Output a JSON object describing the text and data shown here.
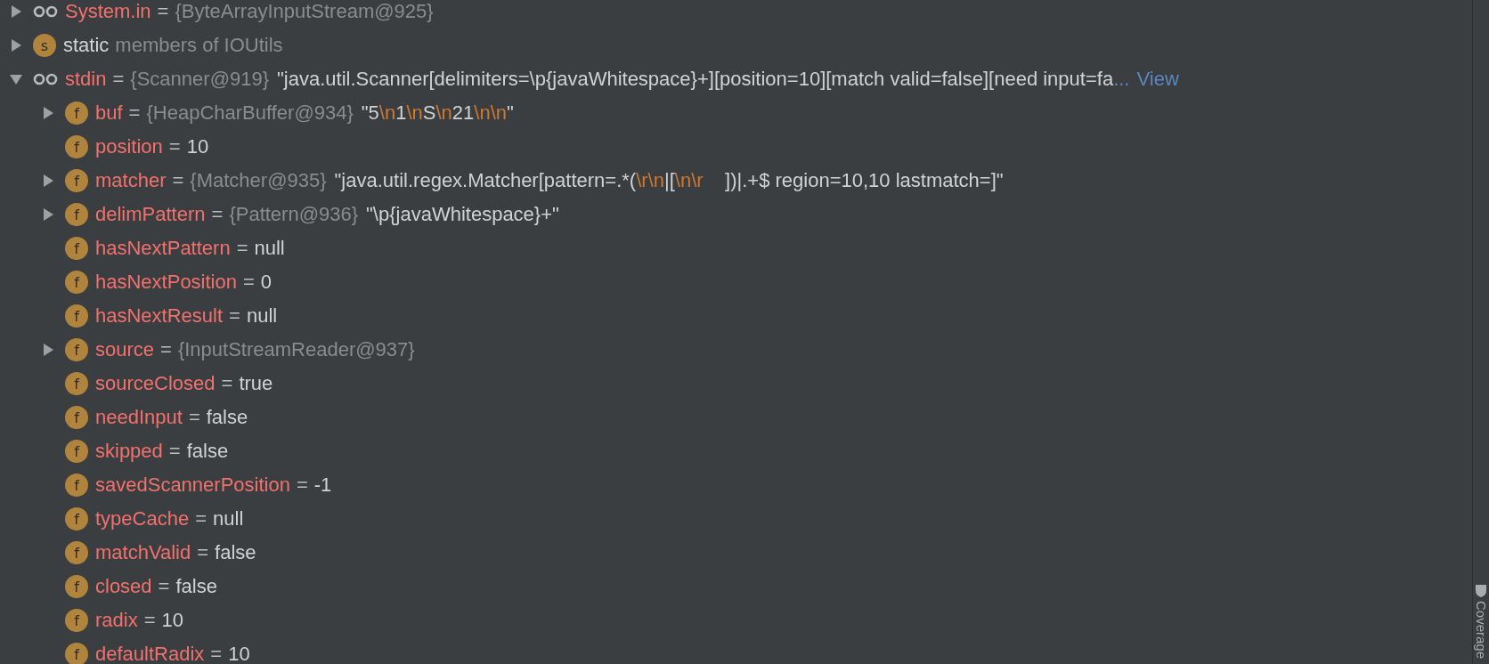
{
  "tree": [
    {
      "kind": "watch",
      "name": "System.in",
      "op": "=",
      "type_ref": "{ByteArrayInputStream@925}",
      "expanded": false
    },
    {
      "kind": "static",
      "badge": "s",
      "name": "static",
      "note": "members of IOUtils",
      "expanded": false
    },
    {
      "kind": "watch",
      "name": "stdin",
      "op": "=",
      "type_ref": "{Scanner@919}",
      "value": [
        {
          "kind": "text",
          "text": "\"java.util.Scanner[delimiters=\\p{javaWhitespace}+][position=10][match valid=false][need input=fa"
        }
      ],
      "more": "...",
      "link": "View",
      "expanded": true,
      "children": [
        {
          "kind": "field",
          "badge": "f",
          "name": "buf",
          "op": "=",
          "type_ref": "{HeapCharBuffer@934}",
          "value": [
            {
              "kind": "text",
              "text": "\"5"
            },
            {
              "kind": "escape",
              "text": "\\n"
            },
            {
              "kind": "text",
              "text": "1"
            },
            {
              "kind": "escape",
              "text": "\\n"
            },
            {
              "kind": "text",
              "text": "S"
            },
            {
              "kind": "escape",
              "text": "\\n"
            },
            {
              "kind": "text",
              "text": "21"
            },
            {
              "kind": "escape",
              "text": "\\n\\n"
            },
            {
              "kind": "text",
              "text": "\""
            }
          ],
          "expanded": false
        },
        {
          "kind": "field",
          "badge": "f",
          "name": "position",
          "op": "=",
          "value": [
            {
              "kind": "text",
              "text": "10"
            }
          ]
        },
        {
          "kind": "field",
          "badge": "f",
          "name": "matcher",
          "op": "=",
          "type_ref": "{Matcher@935}",
          "value": [
            {
              "kind": "text",
              "text": "\"java.util.regex.Matcher[pattern=.*("
            },
            {
              "kind": "escape",
              "text": "\\r\\n"
            },
            {
              "kind": "text",
              "text": "|["
            },
            {
              "kind": "escape",
              "text": "\\n\\r"
            },
            {
              "kind": "text",
              "text": "    ])|.+$ region=10,10 lastmatch=]\""
            }
          ],
          "expanded": false
        },
        {
          "kind": "field",
          "badge": "f",
          "name": "delimPattern",
          "op": "=",
          "type_ref": "{Pattern@936}",
          "value": [
            {
              "kind": "text",
              "text": "\"\\p{javaWhitespace}+\""
            }
          ],
          "expanded": false
        },
        {
          "kind": "field",
          "badge": "f",
          "name": "hasNextPattern",
          "op": "=",
          "value": [
            {
              "kind": "text",
              "text": "null"
            }
          ]
        },
        {
          "kind": "field",
          "badge": "f",
          "name": "hasNextPosition",
          "op": "=",
          "value": [
            {
              "kind": "text",
              "text": "0"
            }
          ]
        },
        {
          "kind": "field",
          "badge": "f",
          "name": "hasNextResult",
          "op": "=",
          "value": [
            {
              "kind": "text",
              "text": "null"
            }
          ]
        },
        {
          "kind": "field",
          "badge": "f",
          "name": "source",
          "op": "=",
          "type_ref": "{InputStreamReader@937}",
          "expanded": false
        },
        {
          "kind": "field",
          "badge": "f",
          "name": "sourceClosed",
          "op": "=",
          "value": [
            {
              "kind": "text",
              "text": "true"
            }
          ]
        },
        {
          "kind": "field",
          "badge": "f",
          "name": "needInput",
          "op": "=",
          "value": [
            {
              "kind": "text",
              "text": "false"
            }
          ]
        },
        {
          "kind": "field",
          "badge": "f",
          "name": "skipped",
          "op": "=",
          "value": [
            {
              "kind": "text",
              "text": "false"
            }
          ]
        },
        {
          "kind": "field",
          "badge": "f",
          "name": "savedScannerPosition",
          "op": "=",
          "value": [
            {
              "kind": "text",
              "text": "-1"
            }
          ]
        },
        {
          "kind": "field",
          "badge": "f",
          "name": "typeCache",
          "op": "=",
          "value": [
            {
              "kind": "text",
              "text": "null"
            }
          ]
        },
        {
          "kind": "field",
          "badge": "f",
          "name": "matchValid",
          "op": "=",
          "value": [
            {
              "kind": "text",
              "text": "false"
            }
          ]
        },
        {
          "kind": "field",
          "badge": "f",
          "name": "closed",
          "op": "=",
          "value": [
            {
              "kind": "text",
              "text": "false"
            }
          ]
        },
        {
          "kind": "field",
          "badge": "f",
          "name": "radix",
          "op": "=",
          "value": [
            {
              "kind": "text",
              "text": "10"
            }
          ]
        },
        {
          "kind": "field",
          "badge": "f",
          "name": "defaultRadix",
          "op": "=",
          "value": [
            {
              "kind": "text",
              "text": "10"
            }
          ]
        }
      ]
    }
  ],
  "side_strip": {
    "label": "Coverage"
  }
}
